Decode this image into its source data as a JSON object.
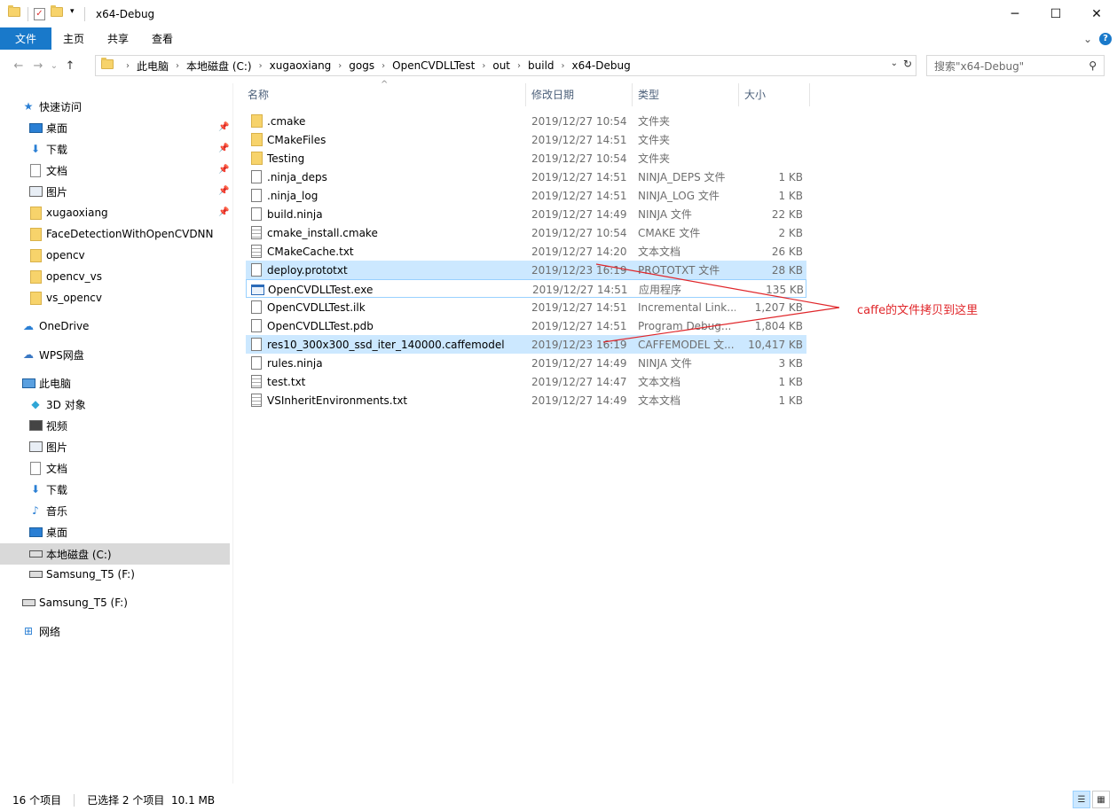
{
  "window": {
    "title": "x64-Debug",
    "minimize": "─",
    "maximize": "☐",
    "close": "✕"
  },
  "ribbon": {
    "tabs": [
      "文件",
      "主页",
      "共享",
      "查看"
    ],
    "expand": "⌄",
    "help": "?"
  },
  "nav": {
    "back": "←",
    "forward": "→",
    "recent": "⌄",
    "up": "↑",
    "breadcrumbs": [
      "此电脑",
      "本地磁盘 (C:)",
      "xugaoxiang",
      "gogs",
      "OpenCVDLLTest",
      "out",
      "build",
      "x64-Debug"
    ],
    "dropdown": "⌄",
    "refresh": "↻",
    "search_placeholder": "搜索\"x64-Debug\"",
    "search_icon": "⚲"
  },
  "sidebar": {
    "quick_access": "快速访问",
    "quick_items": [
      {
        "label": "桌面",
        "icon": "desktop-icon",
        "pinned": true
      },
      {
        "label": "下载",
        "icon": "download-icon",
        "pinned": true
      },
      {
        "label": "文档",
        "icon": "document-icon",
        "pinned": true
      },
      {
        "label": "图片",
        "icon": "pictures-icon",
        "pinned": true
      },
      {
        "label": "xugaoxiang",
        "icon": "folder-icon",
        "pinned": true
      },
      {
        "label": "FaceDetectionWithOpenCVDNN",
        "icon": "folder-icon",
        "pinned": false
      },
      {
        "label": "opencv",
        "icon": "folder-icon",
        "pinned": false
      },
      {
        "label": "opencv_vs",
        "icon": "folder-icon",
        "pinned": false
      },
      {
        "label": "vs_opencv",
        "icon": "folder-icon",
        "pinned": false
      }
    ],
    "onedrive": "OneDrive",
    "wps": "WPS网盘",
    "this_pc": "此电脑",
    "pc_items": [
      {
        "label": "3D 对象",
        "icon": "3d-objects-icon"
      },
      {
        "label": "视频",
        "icon": "video-icon"
      },
      {
        "label": "图片",
        "icon": "pictures-icon"
      },
      {
        "label": "文档",
        "icon": "document-icon"
      },
      {
        "label": "下载",
        "icon": "download-icon"
      },
      {
        "label": "音乐",
        "icon": "music-icon"
      },
      {
        "label": "桌面",
        "icon": "desktop-icon"
      },
      {
        "label": "本地磁盘 (C:)",
        "icon": "drive-icon",
        "selected": true
      },
      {
        "label": "Samsung_T5 (F:)",
        "icon": "usb-drive-icon"
      }
    ],
    "samsung": "Samsung_T5 (F:)",
    "network": "网络",
    "pin_glyph": "📌"
  },
  "columns": {
    "name": "名称",
    "date": "修改日期",
    "type": "类型",
    "size": "大小",
    "sort_caret": "^"
  },
  "files": [
    {
      "name": ".cmake",
      "date": "2019/12/27 10:54",
      "type": "文件夹",
      "size": "",
      "kind": "folder"
    },
    {
      "name": "CMakeFiles",
      "date": "2019/12/27 14:51",
      "type": "文件夹",
      "size": "",
      "kind": "folder"
    },
    {
      "name": "Testing",
      "date": "2019/12/27 10:54",
      "type": "文件夹",
      "size": "",
      "kind": "folder"
    },
    {
      "name": ".ninja_deps",
      "date": "2019/12/27 14:51",
      "type": "NINJA_DEPS 文件",
      "size": "1 KB",
      "kind": "file"
    },
    {
      "name": ".ninja_log",
      "date": "2019/12/27 14:51",
      "type": "NINJA_LOG 文件",
      "size": "1 KB",
      "kind": "file"
    },
    {
      "name": "build.ninja",
      "date": "2019/12/27 14:49",
      "type": "NINJA 文件",
      "size": "22 KB",
      "kind": "file"
    },
    {
      "name": "cmake_install.cmake",
      "date": "2019/12/27 10:54",
      "type": "CMAKE 文件",
      "size": "2 KB",
      "kind": "text"
    },
    {
      "name": "CMakeCache.txt",
      "date": "2019/12/27 14:20",
      "type": "文本文档",
      "size": "26 KB",
      "kind": "text"
    },
    {
      "name": "deploy.prototxt",
      "date": "2019/12/23 16:19",
      "type": "PROTOTXT 文件",
      "size": "28 KB",
      "kind": "file",
      "state": "sel"
    },
    {
      "name": "OpenCVDLLTest.exe",
      "date": "2019/12/27 14:51",
      "type": "应用程序",
      "size": "135 KB",
      "kind": "exe",
      "state": "focus"
    },
    {
      "name": "OpenCVDLLTest.ilk",
      "date": "2019/12/27 14:51",
      "type": "Incremental Link...",
      "size": "1,207 KB",
      "kind": "file"
    },
    {
      "name": "OpenCVDLLTest.pdb",
      "date": "2019/12/27 14:51",
      "type": "Program Debug...",
      "size": "1,804 KB",
      "kind": "file"
    },
    {
      "name": "res10_300x300_ssd_iter_140000.caffemodel",
      "date": "2019/12/23 16:19",
      "type": "CAFFEMODEL 文...",
      "size": "10,417 KB",
      "kind": "file",
      "state": "sel"
    },
    {
      "name": "rules.ninja",
      "date": "2019/12/27 14:49",
      "type": "NINJA 文件",
      "size": "3 KB",
      "kind": "file"
    },
    {
      "name": "test.txt",
      "date": "2019/12/27 14:47",
      "type": "文本文档",
      "size": "1 KB",
      "kind": "text"
    },
    {
      "name": "VSInheritEnvironments.txt",
      "date": "2019/12/27 14:49",
      "type": "文本文档",
      "size": "1 KB",
      "kind": "text"
    }
  ],
  "annotation": {
    "text": "caffe的文件拷贝到这里",
    "color": "#e0262a"
  },
  "status": {
    "count": "16 个项目",
    "selected": "已选择 2 个项目  10.1 MB",
    "details_view": "☰",
    "tiles_view": "▦"
  },
  "colors": {
    "accent": "#1979ca",
    "selection": "#cce8ff",
    "folder": "#f7d36b"
  }
}
